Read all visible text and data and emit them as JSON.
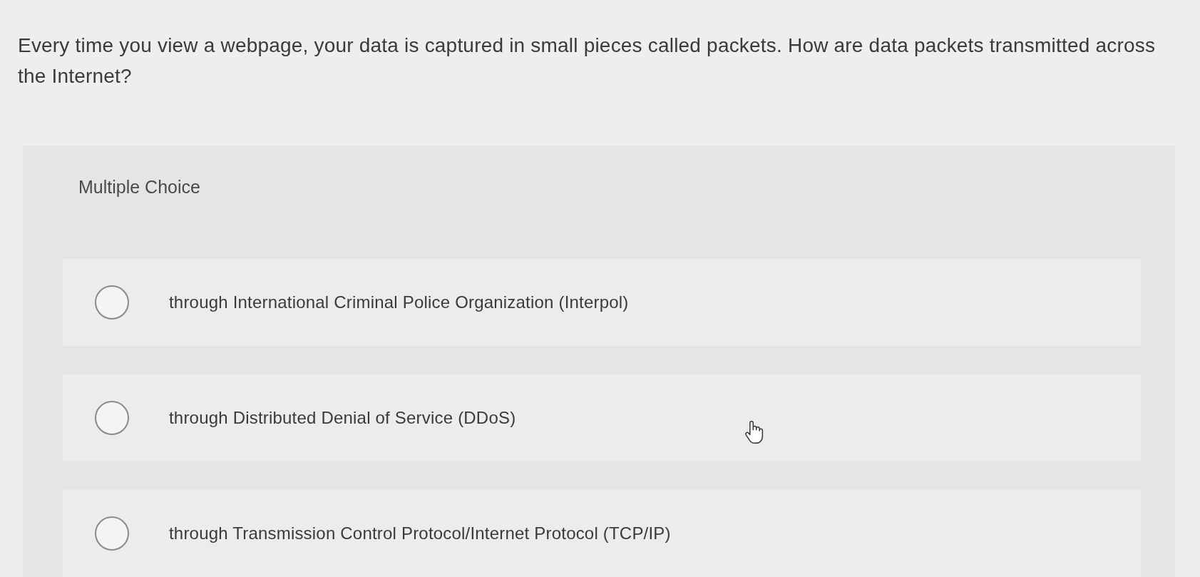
{
  "question": {
    "text": "Every time you view a webpage, your data is captured in small pieces called packets. How are data packets transmitted across the Internet?"
  },
  "answer_panel": {
    "heading": "Multiple Choice",
    "options": [
      {
        "text": "through International Criminal Police Organization (Interpol)",
        "selected": false
      },
      {
        "text": "through Distributed Denial of Service (DDoS)",
        "selected": false
      },
      {
        "text": "through Transmission Control Protocol/Internet Protocol (TCP/IP)",
        "selected": false
      }
    ]
  }
}
